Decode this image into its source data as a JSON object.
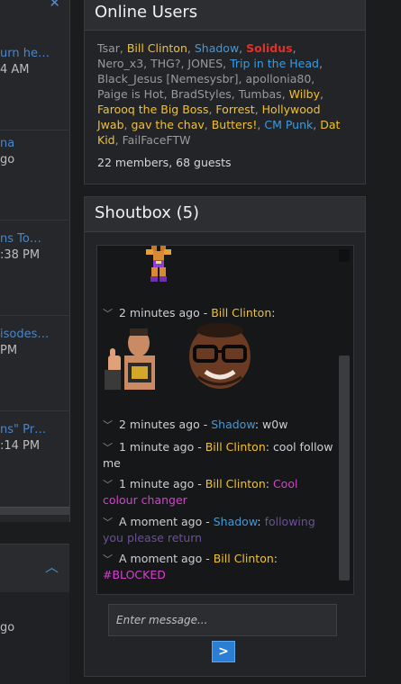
{
  "left": {
    "items": [
      {
        "line1": "urn he…",
        "line2": "4 AM"
      },
      {
        "line1": "na",
        "line2": "go"
      },
      {
        "line1": "ns To…",
        "line2": ":38 PM"
      },
      {
        "line1": "isodes…",
        "line2": "PM"
      },
      {
        "line1": "ns\" Pr…",
        "line2": ":14 PM"
      }
    ],
    "bottom_text": "go"
  },
  "online_users": {
    "title": "Online Users",
    "users": [
      {
        "name": "Tsar",
        "role": "grey"
      },
      {
        "name": "Bill Clinton",
        "role": "gold"
      },
      {
        "name": "Shadow",
        "role": "blue"
      },
      {
        "name": "Solidus",
        "role": "red"
      },
      {
        "name": "Nero_x3",
        "role": "grey"
      },
      {
        "name": "THG?",
        "role": "grey"
      },
      {
        "name": "JONES",
        "role": "grey"
      },
      {
        "name": "Trip in the Head",
        "role": "blue"
      },
      {
        "name": "Black_Jesus [Nemesysbr]",
        "role": "grey"
      },
      {
        "name": "apollonia80",
        "role": "grey"
      },
      {
        "name": "Paige is Hot",
        "role": "grey"
      },
      {
        "name": "BradStyles",
        "role": "grey"
      },
      {
        "name": "Tumbas",
        "role": "grey"
      },
      {
        "name": "Wilby",
        "role": "gold"
      },
      {
        "name": "Farooq the Big Boss",
        "role": "gold"
      },
      {
        "name": "Forrest",
        "role": "gold"
      },
      {
        "name": "Hollywood Jwab",
        "role": "gold"
      },
      {
        "name": "gav the chav",
        "role": "gold"
      },
      {
        "name": "Butters!",
        "role": "gold"
      },
      {
        "name": "CM Punk",
        "role": "blue"
      },
      {
        "name": "Dat Kid",
        "role": "gold"
      },
      {
        "name": "FailFaceFTW",
        "role": "grey"
      }
    ],
    "summary": "22 members, 68 guests"
  },
  "shoutbox": {
    "title": "Shoutbox (5)",
    "messages": [
      {
        "time": "2 minutes ago",
        "user": "Bill Clinton",
        "user_role": "gold",
        "text": "",
        "text_style": "normal"
      },
      {
        "time": "2 minutes ago",
        "user": "Shadow",
        "user_role": "blue",
        "text": "w0w",
        "text_style": "normal"
      },
      {
        "time": "1 minute ago",
        "user": "Bill Clinton",
        "user_role": "gold",
        "text": "cool follow me",
        "text_style": "normal"
      },
      {
        "time": "1 minute ago",
        "user": "Bill Clinton",
        "user_role": "gold",
        "text": "Cool colour changer",
        "text_style": "magenta"
      },
      {
        "time": "A moment ago",
        "user": "Shadow",
        "user_role": "blue",
        "text": "following you please return",
        "text_style": "purple"
      },
      {
        "time": "A moment ago",
        "user": "Bill Clinton",
        "user_role": "gold",
        "text": "#BLOCKED",
        "text_style": "magenta"
      }
    ],
    "separator": " - ",
    "input_placeholder": "Enter message...",
    "send_label": ">"
  },
  "colors": {
    "gold": "#f2c12e",
    "blue": "#3a9be0",
    "red": "#e0302a",
    "magenta": "#d93fd0",
    "purple": "#6d4f9b",
    "accent": "#2a7fd4"
  }
}
